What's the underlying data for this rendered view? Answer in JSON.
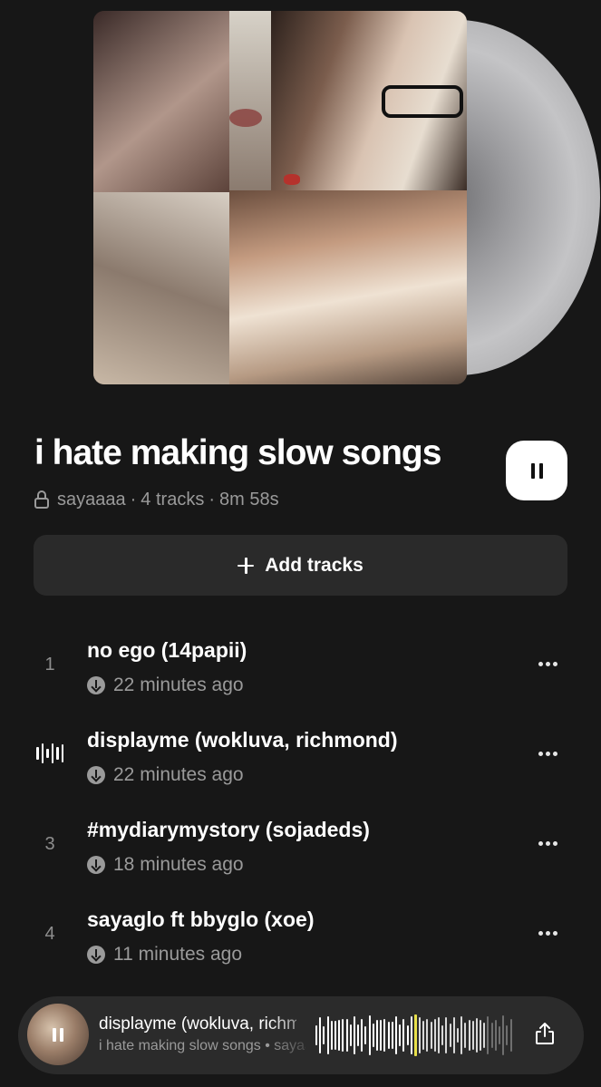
{
  "playlist": {
    "title": "i hate making slow songs",
    "owner": "sayaaaa",
    "track_count": "4 tracks",
    "duration": "8m 58s",
    "separator": "·"
  },
  "actions": {
    "add_tracks_label": "Add tracks"
  },
  "tracks": [
    {
      "number": "1",
      "title": "no ego (14papii)",
      "added": "22 minutes ago",
      "playing": false
    },
    {
      "number": "",
      "title": "displayme (wokluva, richmond)",
      "added": "22 minutes ago",
      "playing": true
    },
    {
      "number": "3",
      "title": "#mydiarymystory (sojadeds)",
      "added": "18 minutes ago",
      "playing": false
    },
    {
      "number": "4",
      "title": "sayaglo ft bbyglo (xoe)",
      "added": "11 minutes ago",
      "playing": false
    }
  ],
  "now_playing": {
    "title": "displayme (wokluva, richmond)",
    "subtitle": "i hate making slow songs • sayaaaa",
    "progress": 0.5
  },
  "icons": {
    "lock": "lock-icon",
    "pause": "pause-icon",
    "plus": "plus-icon",
    "download": "download-icon",
    "more": "more-icon",
    "playing": "now-playing-icon",
    "share": "share-icon"
  },
  "colors": {
    "background": "#171717",
    "surface": "#2a2a2a",
    "text": "#ffffff",
    "muted": "#9a9a9a",
    "waveform_cursor": "#e8e04a"
  }
}
